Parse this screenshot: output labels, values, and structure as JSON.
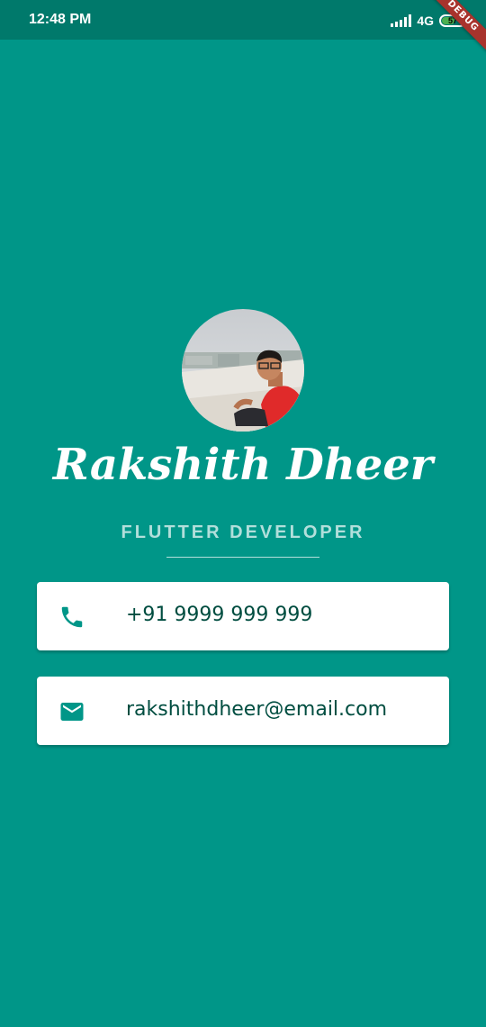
{
  "status_bar": {
    "time": "12:48 PM",
    "network": "4G",
    "battery": "57"
  },
  "debug_banner": "DEBUG",
  "profile": {
    "name": "Rakshith Dheer",
    "title": "FLUTTER DEVELOPER",
    "avatar_icon": "profile-photo"
  },
  "contacts": {
    "phone": {
      "icon": "phone-icon",
      "value": "+91 9999 999 999"
    },
    "email": {
      "icon": "mail-icon",
      "value": "rakshithdheer@email.com"
    }
  },
  "colors": {
    "background": "#009688",
    "status_bar": "#00796b",
    "title_text": "#b2dfdb",
    "card_text": "#004d40",
    "icon": "#009688"
  }
}
